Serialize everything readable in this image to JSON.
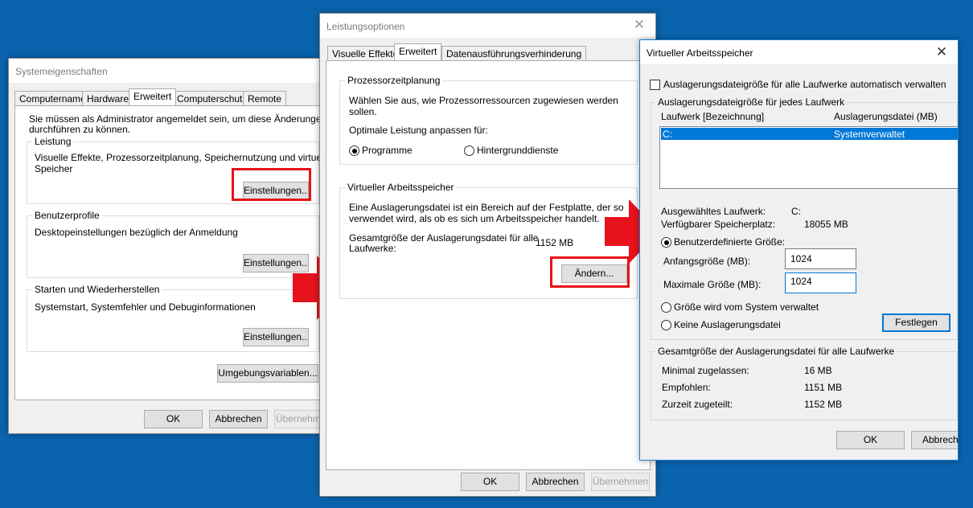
{
  "sysprops": {
    "title": "Systemeigenschaften",
    "tabs": [
      "Computername",
      "Hardware",
      "Erweitert",
      "Computerschutz",
      "Remote"
    ],
    "admin_note_line1": "Sie müssen als Administrator angemeldet sein, um diese Änderungen",
    "admin_note_line2": "durchführen zu können.",
    "leistung": {
      "legend": "Leistung",
      "desc_line1": "Visuelle Effekte, Prozessorzeitplanung, Speichernutzung und virtueller",
      "desc_line2": "Speicher",
      "button": "Einstellungen..."
    },
    "benutzerprofile": {
      "legend": "Benutzerprofile",
      "desc": "Desktopeinstellungen bezüglich der Anmeldung",
      "button": "Einstellungen..."
    },
    "starten": {
      "legend": "Starten und Wiederherstellen",
      "desc": "Systemstart, Systemfehler und Debuginformationen",
      "button": "Einstellungen..."
    },
    "env_button": "Umgebungsvariablen...",
    "ok": "OK",
    "cancel": "Abbrechen",
    "apply": "Übernehmen"
  },
  "perfopts": {
    "title": "Leistungsoptionen",
    "tabs": [
      "Visuelle Effekte",
      "Erweitert",
      "Datenausführungsverhinderung"
    ],
    "proz": {
      "legend": "Prozessorzeitplanung",
      "desc_line1": "Wählen Sie aus, wie Prozessorressourcen zugewiesen werden",
      "desc_line2": "sollen.",
      "optimize_label": "Optimale Leistung anpassen für:",
      "radio_programs": "Programme",
      "radio_background": "Hintergrunddienste"
    },
    "vmem": {
      "legend": "Virtueller Arbeitsspeicher",
      "desc_line1": "Eine Auslagerungsdatei ist ein Bereich auf der Festplatte, der so",
      "desc_line2": "verwendet wird, als ob es sich um Arbeitsspeicher handelt.",
      "total_label_line1": "Gesamtgröße der Auslagerungsdatei für alle",
      "total_label_line2": "Laufwerke:",
      "total_value": "1152 MB",
      "change_button": "Ändern..."
    },
    "ok": "OK",
    "cancel": "Abbrechen",
    "apply": "Übernehmen"
  },
  "vmemdlg": {
    "title": "Virtueller Arbeitsspeicher",
    "auto_manage": "Auslagerungsdateigröße für alle Laufwerke automatisch verwalten",
    "per_drive_legend": "Auslagerungsdateigröße für jedes Laufwerk",
    "list_headers": [
      "Laufwerk [Bezeichnung]",
      "Auslagerungsdatei (MB)"
    ],
    "list_rows": [
      {
        "drive": "C:",
        "pagefile": "Systemverwaltet"
      }
    ],
    "selected_drive_label": "Ausgewähltes Laufwerk:",
    "selected_drive_value": "C:",
    "available_label": "Verfügbarer Speicherplatz:",
    "available_value": "18055 MB",
    "custom_size": "Benutzerdefinierte Größe:",
    "initial_label": "Anfangsgröße (MB):",
    "initial_value": "1024",
    "max_label": "Maximale Größe (MB):",
    "max_value": "1024",
    "system_managed": "Größe wird vom System verwaltet",
    "no_pagefile": "Keine Auslagerungsdatei",
    "set_button": "Festlegen",
    "total_legend": "Gesamtgröße der Auslagerungsdatei für alle Laufwerke",
    "min_label": "Minimal zugelassen:",
    "min_value": "16 MB",
    "recommended_label": "Empfohlen:",
    "recommended_value": "1151 MB",
    "allocated_label": "Zurzeit zugeteilt:",
    "allocated_value": "1152 MB",
    "ok": "OK",
    "cancel": "Abbrechen"
  },
  "icons": {
    "close": "close-icon",
    "arrow": "red-arrow-icon"
  },
  "colors": {
    "desktop": "#0a64ad",
    "highlight_red": "#e8121c",
    "selection": "#0078d7"
  }
}
